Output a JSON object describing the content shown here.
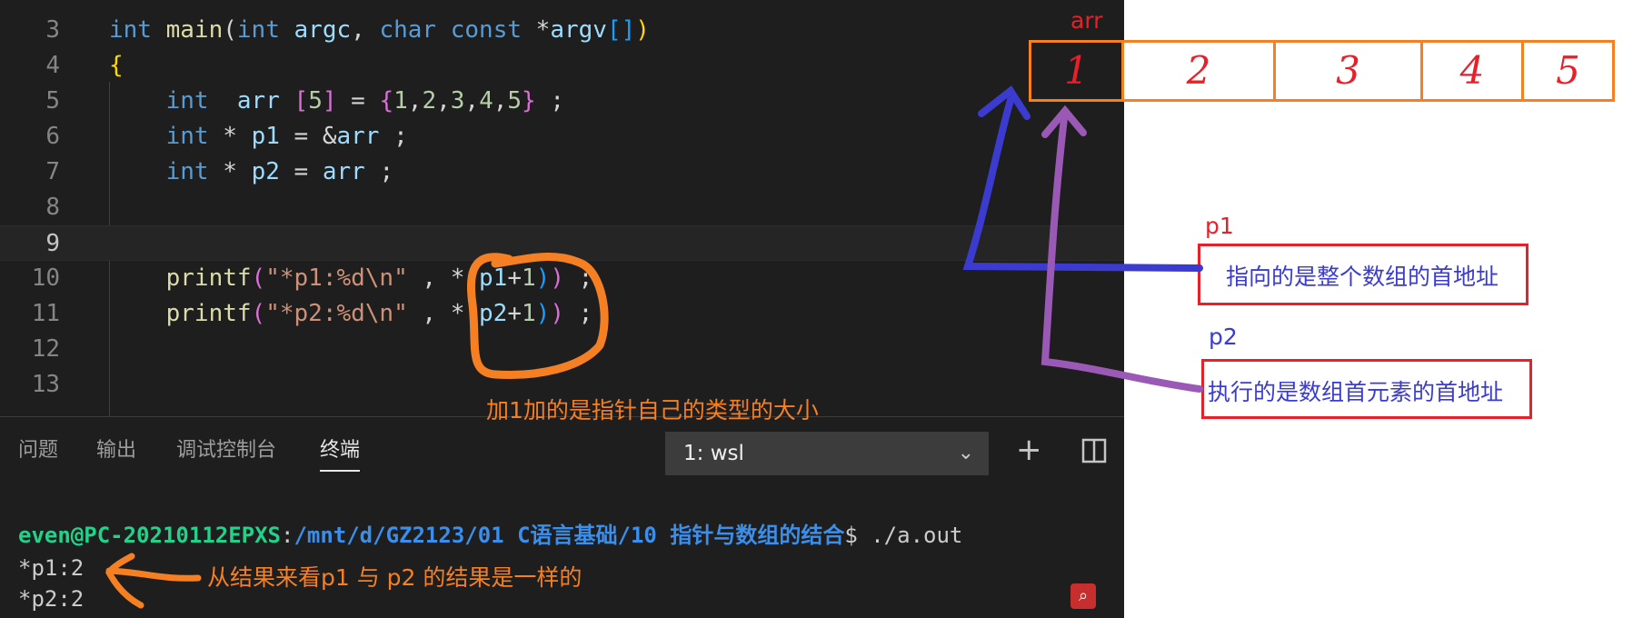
{
  "editor": {
    "lines": [
      {
        "num": "3",
        "tokens": [
          [
            "kw",
            "int"
          ],
          [
            "op",
            " "
          ],
          [
            "fn",
            "main"
          ],
          [
            "op",
            "("
          ],
          [
            "kw",
            "int"
          ],
          [
            "op",
            " "
          ],
          [
            "var",
            "argc"
          ],
          [
            "op",
            ", "
          ],
          [
            "kw",
            "char"
          ],
          [
            "op",
            " "
          ],
          [
            "kw",
            "const"
          ],
          [
            "op",
            " *"
          ],
          [
            "var",
            "argv"
          ],
          [
            "br3",
            "[]"
          ],
          [
            "br1",
            ")"
          ]
        ]
      },
      {
        "num": "4",
        "tokens": [
          [
            "br1",
            "{"
          ]
        ]
      },
      {
        "num": "5",
        "tokens": [
          [
            "op",
            "    "
          ],
          [
            "kw",
            "int"
          ],
          [
            "op",
            "  "
          ],
          [
            "var",
            "arr"
          ],
          [
            "op",
            " "
          ],
          [
            "br2",
            "["
          ],
          [
            "num",
            "5"
          ],
          [
            "br2",
            "]"
          ],
          [
            "op",
            " = "
          ],
          [
            "br2",
            "{"
          ],
          [
            "num",
            "1"
          ],
          [
            "op",
            ","
          ],
          [
            "num",
            "2"
          ],
          [
            "op",
            ","
          ],
          [
            "num",
            "3"
          ],
          [
            "op",
            ","
          ],
          [
            "num",
            "4"
          ],
          [
            "op",
            ","
          ],
          [
            "num",
            "5"
          ],
          [
            "br2",
            "}"
          ],
          [
            "op",
            " ;"
          ]
        ]
      },
      {
        "num": "6",
        "tokens": [
          [
            "op",
            "    "
          ],
          [
            "kw",
            "int"
          ],
          [
            "op",
            " * "
          ],
          [
            "var",
            "p1"
          ],
          [
            "op",
            " = &"
          ],
          [
            "var",
            "arr"
          ],
          [
            "op",
            " ;"
          ]
        ]
      },
      {
        "num": "7",
        "tokens": [
          [
            "op",
            "    "
          ],
          [
            "kw",
            "int"
          ],
          [
            "op",
            " * "
          ],
          [
            "var",
            "p2"
          ],
          [
            "op",
            " = "
          ],
          [
            "var",
            "arr"
          ],
          [
            "op",
            " ;"
          ]
        ]
      },
      {
        "num": "8",
        "tokens": []
      },
      {
        "num": "9",
        "tokens": []
      },
      {
        "num": "10",
        "tokens": [
          [
            "op",
            "    "
          ],
          [
            "fn",
            "printf"
          ],
          [
            "br2",
            "("
          ],
          [
            "str",
            "\"*p1:%d\\n\""
          ],
          [
            "op",
            " , *"
          ],
          [
            "br3",
            "("
          ],
          [
            "var",
            "p1"
          ],
          [
            "op",
            "+"
          ],
          [
            "num",
            "1"
          ],
          [
            "br3",
            ")"
          ],
          [
            "br2",
            ")"
          ],
          [
            "op",
            " ;"
          ]
        ]
      },
      {
        "num": "11",
        "tokens": [
          [
            "op",
            "    "
          ],
          [
            "fn",
            "printf"
          ],
          [
            "br2",
            "("
          ],
          [
            "str",
            "\"*p2:%d\\n\""
          ],
          [
            "op",
            " , *"
          ],
          [
            "br3",
            "("
          ],
          [
            "var",
            "p2"
          ],
          [
            "op",
            "+"
          ],
          [
            "num",
            "1"
          ],
          [
            "br3",
            ")"
          ],
          [
            "br2",
            ")"
          ],
          [
            "op",
            " ;"
          ]
        ]
      },
      {
        "num": "12",
        "tokens": []
      },
      {
        "num": "13",
        "tokens": []
      }
    ],
    "active_line": "9"
  },
  "panel": {
    "tabs": [
      "问题",
      "输出",
      "调试控制台",
      "终端"
    ],
    "active_tab": "终端",
    "terminal_select": "1: wsl",
    "plus_icon": "plus-icon",
    "split_icon": "split-icon"
  },
  "terminal": {
    "user": "even@PC-20210112EPXS",
    "sep": ":",
    "path": "/mnt/d/GZ2123/01 C语言基础/10 指针与数组的结合",
    "prompt": "$ ./a.out",
    "out1": "*p1:2",
    "out2": "*p2:2"
  },
  "annotations": {
    "arr_label": "arr",
    "cells": [
      "1",
      "2",
      "3",
      "4",
      "5"
    ],
    "p1_label": "p1",
    "p1_desc": "指向的是整个数组的首地址",
    "p2_label": "p2",
    "p2_desc": "执行的是数组首元素的首地址",
    "plus_note": "加1加的是指针自己的类型的大小",
    "result_note": "从结果来看p1 与 p2 的结果是一样的"
  },
  "colors": {
    "orange": "#f58024",
    "red": "#e8202a",
    "blue": "#3b3bd0",
    "purple": "#9b59b6"
  }
}
